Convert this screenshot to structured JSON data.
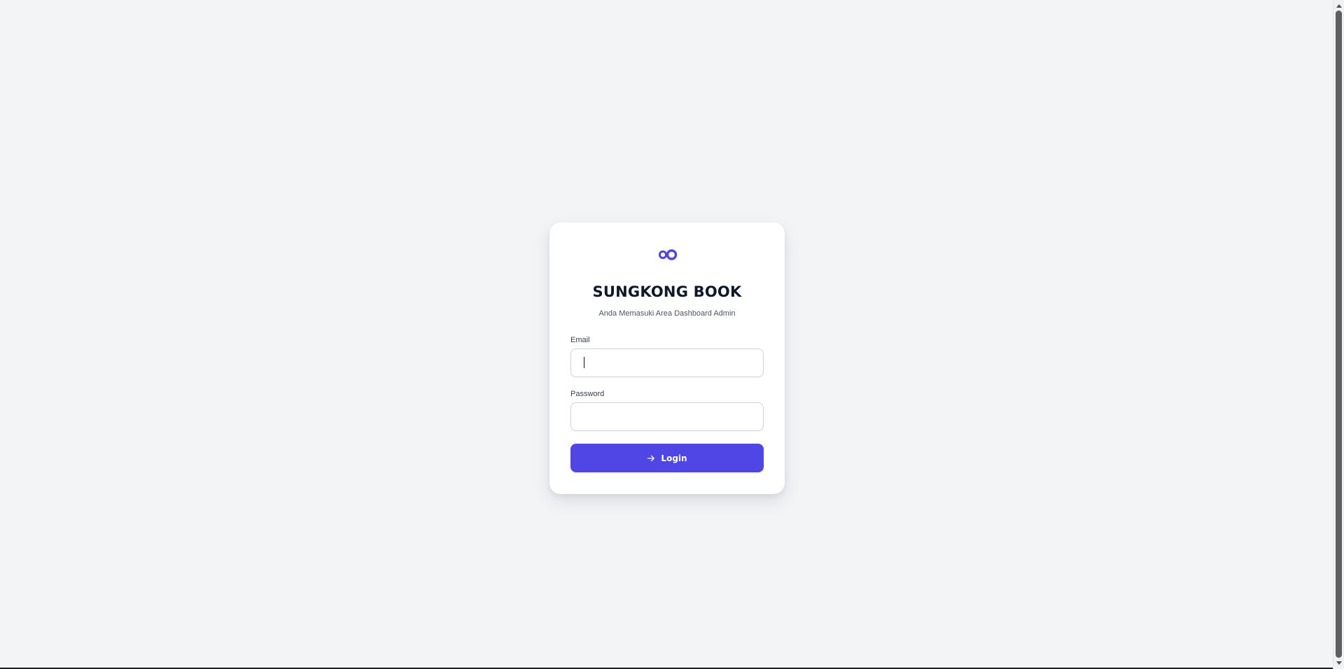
{
  "brand": {
    "title": "SUNGKONG BOOK",
    "subtitle": "Anda Memasuki Area Dashboard Admin",
    "logo_icon": "infinity-rings-icon",
    "accent_color": "#4f46e5"
  },
  "form": {
    "email": {
      "label": "Email",
      "value": "",
      "placeholder": ""
    },
    "password": {
      "label": "Password",
      "value": "",
      "placeholder": ""
    },
    "submit": {
      "label": "Login",
      "icon": "arrow-right-icon"
    }
  },
  "colors": {
    "page_background": "#f3f4f6",
    "card_background": "#ffffff",
    "button_background": "#4f46e5",
    "button_text": "#ffffff",
    "title_text": "#111827"
  }
}
